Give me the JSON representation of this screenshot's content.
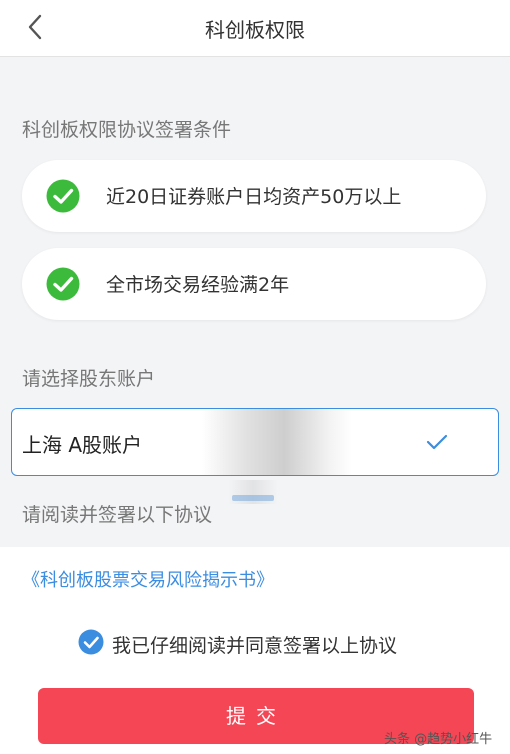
{
  "header": {
    "title": "科创板权限"
  },
  "conditions": {
    "label": "科创板权限协议签署条件",
    "items": [
      {
        "text": "近20日证券账户日均资产50万以上",
        "met": true
      },
      {
        "text": "全市场交易经验满2年",
        "met": true
      }
    ]
  },
  "account": {
    "label": "请选择股东账户",
    "selected": "上海 A股账户"
  },
  "agreement": {
    "label": "请阅读并签署以下协议",
    "link": "《科创板股票交易风险揭示书》"
  },
  "consent": {
    "text": "我已仔细阅读并同意签署以上协议",
    "checked": true
  },
  "submit": {
    "label": "提交"
  },
  "watermark": {
    "text": "头条 @趋势小红牛"
  },
  "colors": {
    "accent_blue": "#3b8de0",
    "check_green": "#3cba3c",
    "submit_red": "#f44655"
  }
}
